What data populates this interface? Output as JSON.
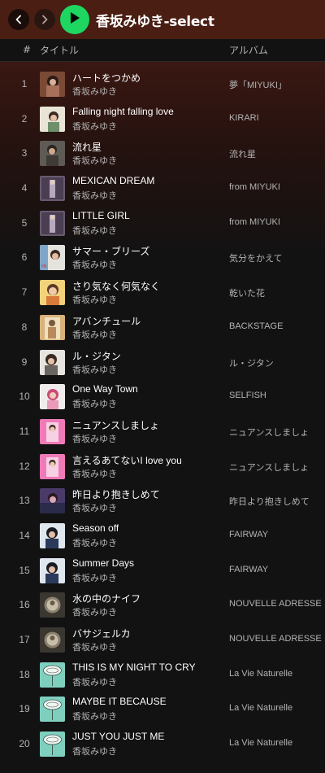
{
  "playlist": {
    "title": "香坂みゆき-select"
  },
  "colors": {
    "accent": "#1ed760",
    "header_bg": "#4a1e13",
    "background": "#121212"
  },
  "icons": {
    "back": "chevron-left-icon",
    "forward": "chevron-right-icon",
    "play": "play-icon"
  },
  "columns": {
    "number": "#",
    "title": "タイトル",
    "album": "アルバム"
  },
  "tracks": [
    {
      "num": "1",
      "title": "ハートをつかめ",
      "artist": "香坂みゆき",
      "album": "夢「MIYUKI」",
      "cover": "c1"
    },
    {
      "num": "2",
      "title": "Falling night falling love",
      "artist": "香坂みゆき",
      "album": "KIRARI",
      "cover": "c2"
    },
    {
      "num": "3",
      "title": "流れ星",
      "artist": "香坂みゆき",
      "album": "流れ星",
      "cover": "c3"
    },
    {
      "num": "4",
      "title": "MEXICAN DREAM",
      "artist": "香坂みゆき",
      "album": "from MIYUKI",
      "cover": "c4"
    },
    {
      "num": "5",
      "title": "LITTLE GIRL",
      "artist": "香坂みゆき",
      "album": "from MIYUKI",
      "cover": "c4"
    },
    {
      "num": "6",
      "title": "サマー・ブリーズ",
      "artist": "香坂みゆき",
      "album": "気分をかえて",
      "cover": "c6"
    },
    {
      "num": "7",
      "title": "さり気なく何気なく",
      "artist": "香坂みゆき",
      "album": "乾いた花",
      "cover": "c7"
    },
    {
      "num": "8",
      "title": "アバンチュール",
      "artist": "香坂みゆき",
      "album": "BACKSTAGE",
      "cover": "c8"
    },
    {
      "num": "9",
      "title": "ル・ジタン",
      "artist": "香坂みゆき",
      "album": "ル・ジタン",
      "cover": "c9"
    },
    {
      "num": "10",
      "title": "One Way Town",
      "artist": "香坂みゆき",
      "album": "SELFISH",
      "cover": "c10"
    },
    {
      "num": "11",
      "title": "ニュアンスしましょ",
      "artist": "香坂みゆき",
      "album": "ニュアンスしましょ",
      "cover": "c11"
    },
    {
      "num": "12",
      "title": "言えるあてないI love you",
      "artist": "香坂みゆき",
      "album": "ニュアンスしましょ",
      "cover": "c11"
    },
    {
      "num": "13",
      "title": "昨日より抱きしめて",
      "artist": "香坂みゆき",
      "album": "昨日より抱きしめて",
      "cover": "c13"
    },
    {
      "num": "14",
      "title": "Season off",
      "artist": "香坂みゆき",
      "album": "FAIRWAY",
      "cover": "c14"
    },
    {
      "num": "15",
      "title": "Summer Days",
      "artist": "香坂みゆき",
      "album": "FAIRWAY",
      "cover": "c14"
    },
    {
      "num": "16",
      "title": "水の中のナイフ",
      "artist": "香坂みゆき",
      "album": "NOUVELLE ADRESSE",
      "cover": "c16"
    },
    {
      "num": "17",
      "title": "バサジェルカ",
      "artist": "香坂みゆき",
      "album": "NOUVELLE ADRESSE",
      "cover": "c16"
    },
    {
      "num": "18",
      "title": "THIS IS MY NIGHT TO CRY",
      "artist": "香坂みゆき",
      "album": "La Vie Naturelle",
      "cover": "c18"
    },
    {
      "num": "19",
      "title": "MAYBE IT BECAUSE",
      "artist": "香坂みゆき",
      "album": "La Vie Naturelle",
      "cover": "c18"
    },
    {
      "num": "20",
      "title": "JUST YOU JUST ME",
      "artist": "香坂みゆき",
      "album": "La Vie Naturelle",
      "cover": "c18"
    }
  ]
}
